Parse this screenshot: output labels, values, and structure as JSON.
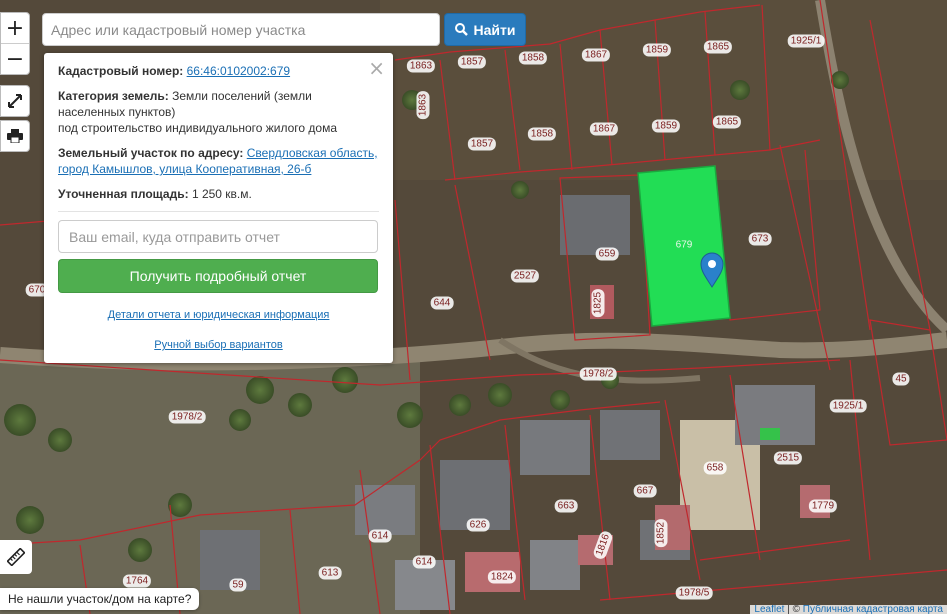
{
  "search": {
    "placeholder": "Адрес или кадастровый номер участка",
    "button_label": "Найти"
  },
  "zoom": {
    "in": "+",
    "out": "−"
  },
  "panel": {
    "cadastral_label": "Кадастровый номер:",
    "cadastral_value": "66:46:0102002:679",
    "category_label": "Категория земель:",
    "category_value": "Земли поселений (земли населенных пунктов)",
    "category_value_extra": "под строительство индивидуального жилого дома",
    "address_label": "Земельный участок по адресу:",
    "address_value": "Свердловская область, город Камышлов, улица Кооперативная, 26-б",
    "area_label": "Уточненная площадь:",
    "area_value": "1 250 кв.м.",
    "email_placeholder": "Ваш email, куда отправить отчет",
    "report_button": "Получить подробный отчет",
    "details_link": "Детали отчета и юридическая информация",
    "manual_link": "Ручной выбор вариантов",
    "close": "×"
  },
  "not_found": "Не нашли участок/дом на карте?",
  "attribution": {
    "leaflet": "Leaflet",
    "sep": " | © ",
    "map": "Публичная кадастровая карта"
  },
  "colors": {
    "selected_plot": "#22dd55",
    "boundary": "#c0282d",
    "marker": "#2a81cb"
  },
  "plots": [
    {
      "label": "1863"
    },
    {
      "label": "1857"
    },
    {
      "label": "1858"
    },
    {
      "label": "1867"
    },
    {
      "label": "1859"
    },
    {
      "label": "1865"
    },
    {
      "label": "1925/1"
    },
    {
      "label": "1863"
    },
    {
      "label": "1858"
    },
    {
      "label": "1867"
    },
    {
      "label": "1859"
    },
    {
      "label": "1865"
    },
    {
      "label": "1857"
    },
    {
      "label": "679"
    },
    {
      "label": "673"
    },
    {
      "label": "659"
    },
    {
      "label": "2527"
    },
    {
      "label": "644"
    },
    {
      "label": "1825"
    },
    {
      "label": "670"
    },
    {
      "label": "1978/2"
    },
    {
      "label": "1978/2"
    },
    {
      "label": "1925/1"
    },
    {
      "label": "45"
    },
    {
      "label": "658"
    },
    {
      "label": "2515"
    },
    {
      "label": "667"
    },
    {
      "label": "1779"
    },
    {
      "label": "663"
    },
    {
      "label": "626"
    },
    {
      "label": "1852"
    },
    {
      "label": "1816"
    },
    {
      "label": "614"
    },
    {
      "label": "614"
    },
    {
      "label": "1824"
    },
    {
      "label": "613"
    },
    {
      "label": "1764"
    },
    {
      "label": "59"
    },
    {
      "label": "1978/5"
    }
  ]
}
